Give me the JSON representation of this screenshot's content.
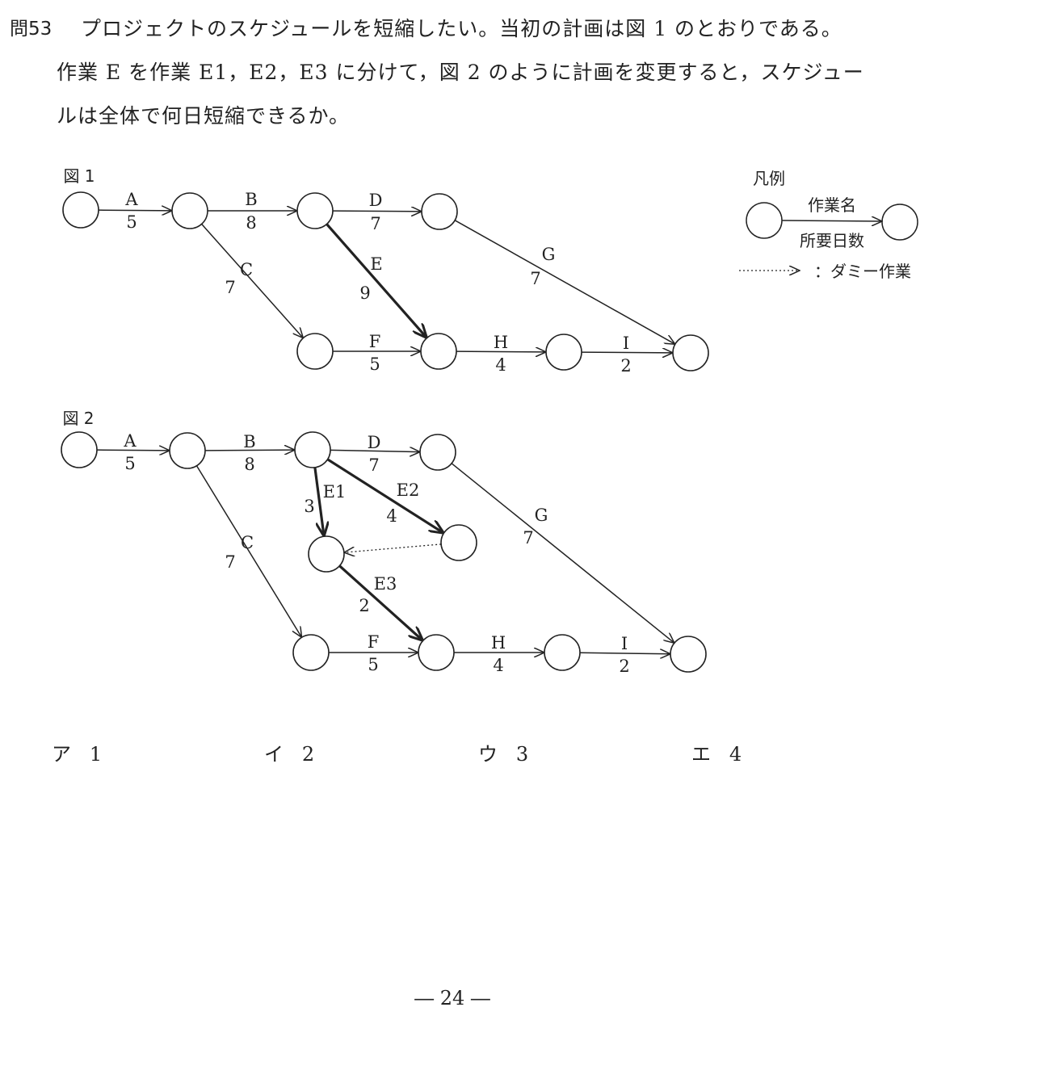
{
  "question": {
    "number": "問53",
    "lines": [
      "プロジェクトのスケジュールを短縮したい。当初の計画は図 1 のとおりである。",
      "作業 E を作業 E1，E2，E3 に分けて，図 2 のように計画を変更すると，スケジュー",
      "ルは全体で何日短縮できるか。"
    ]
  },
  "figure1": {
    "title": "図 1",
    "edges": [
      {
        "name": "A",
        "days": "5"
      },
      {
        "name": "B",
        "days": "8"
      },
      {
        "name": "D",
        "days": "7"
      },
      {
        "name": "C",
        "days": "7"
      },
      {
        "name": "E",
        "days": "9",
        "critical": true
      },
      {
        "name": "F",
        "days": "5"
      },
      {
        "name": "H",
        "days": "4"
      },
      {
        "name": "I",
        "days": "2"
      },
      {
        "name": "G",
        "days": "7"
      }
    ]
  },
  "figure2": {
    "title": "図 2",
    "edges": [
      {
        "name": "A",
        "days": "5"
      },
      {
        "name": "B",
        "days": "8"
      },
      {
        "name": "D",
        "days": "7"
      },
      {
        "name": "E1",
        "days": "3",
        "critical": true
      },
      {
        "name": "E2",
        "days": "4",
        "critical": true
      },
      {
        "name": "E3",
        "days": "2",
        "critical": true
      },
      {
        "name": "C",
        "days": "7"
      },
      {
        "name": "F",
        "days": "5"
      },
      {
        "name": "H",
        "days": "4"
      },
      {
        "name": "I",
        "days": "2"
      },
      {
        "name": "G",
        "days": "7"
      },
      {
        "name": "dummy",
        "days": ""
      }
    ]
  },
  "legend": {
    "title": "凡例",
    "task_name": "作業名",
    "duration": "所要日数",
    "dummy": "：ダミー作業"
  },
  "answers": [
    {
      "label": "ア",
      "value": "1"
    },
    {
      "label": "イ",
      "value": "2"
    },
    {
      "label": "ウ",
      "value": "3"
    },
    {
      "label": "エ",
      "value": "4"
    }
  ],
  "page_number": "― 24 ―"
}
